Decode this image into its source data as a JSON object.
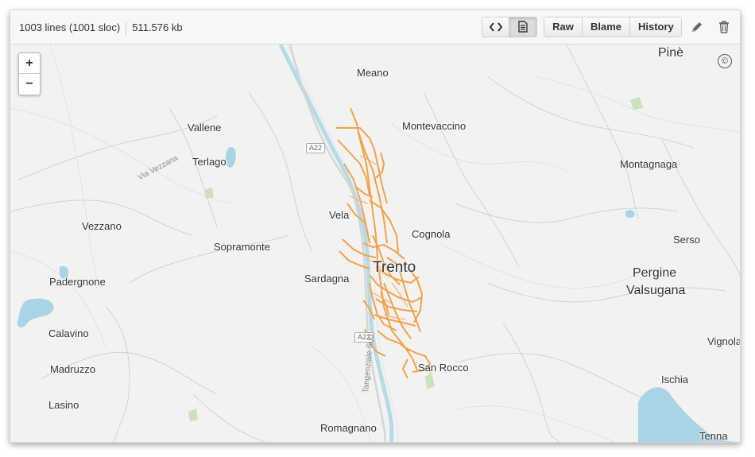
{
  "file_info": {
    "lines": "1003 lines (1001 sloc)",
    "size": "511.576 kb"
  },
  "toolbar": {
    "code_view_icon": "code-icon",
    "rendered_view_icon": "file-text-icon",
    "raw_label": "Raw",
    "blame_label": "Blame",
    "history_label": "History",
    "edit_icon": "pencil-icon",
    "delete_icon": "trash-icon"
  },
  "map": {
    "zoom_in": "+",
    "zoom_out": "−",
    "attribution": "©",
    "route_color": "#f5a04a",
    "places": {
      "pine": "Pinè",
      "meano": "Meano",
      "montevaccino": "Montevaccino",
      "vallene": "Vallene",
      "terlago": "Terlago",
      "montagnaga": "Montagnaga",
      "vela": "Vela",
      "vezzano": "Vezzano",
      "cognola": "Cognola",
      "serso": "Serso",
      "sopramonte": "Sopramonte",
      "trento": "Trento",
      "pergine": "Pergine",
      "valsugana": "Valsugana",
      "sardagna": "Sardagna",
      "padergnone": "Padergnone",
      "calavino": "Calavino",
      "vignola": "Vignola",
      "madruzzo": "Madruzzo",
      "san_rocco": "San Rocco",
      "ischia": "Ischia",
      "lasino": "Lasino",
      "romagnano": "Romagnano",
      "tenna": "Tenna"
    },
    "roads": {
      "a22_north": "A22",
      "a22_south": "A22",
      "via_vezzana": "Via Vezzana",
      "tangenziale_sud": "Tangenziale Sud"
    }
  }
}
